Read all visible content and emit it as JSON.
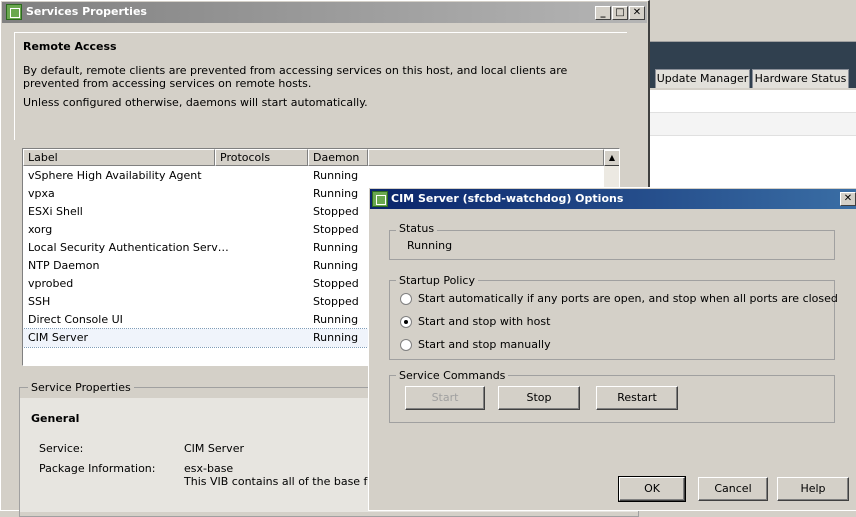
{
  "background_app": {
    "tabs": [
      "Update Manager",
      "Hardware Status"
    ]
  },
  "services_window": {
    "title": "Services Properties",
    "section_heading": "Remote Access",
    "description": "By default, remote clients are prevented from accessing services on this host, and local clients are prevented from accessing services on remote hosts.",
    "daemon_note": "Unless configured otherwise, daemons will start automatically.",
    "columns": [
      "Label",
      "Protocols",
      "Daemon"
    ],
    "rows": [
      {
        "label": "vSphere High Availability Agent",
        "protocols": "",
        "daemon": "Running"
      },
      {
        "label": "vpxa",
        "protocols": "",
        "daemon": "Running"
      },
      {
        "label": "ESXi Shell",
        "protocols": "",
        "daemon": "Stopped"
      },
      {
        "label": "xorg",
        "protocols": "",
        "daemon": "Stopped"
      },
      {
        "label": "Local Security Authentication Serv…",
        "protocols": "",
        "daemon": "Running"
      },
      {
        "label": "NTP Daemon",
        "protocols": "",
        "daemon": "Running"
      },
      {
        "label": "vprobed",
        "protocols": "",
        "daemon": "Stopped"
      },
      {
        "label": "SSH",
        "protocols": "",
        "daemon": "Stopped"
      },
      {
        "label": "Direct Console UI",
        "protocols": "",
        "daemon": "Running"
      },
      {
        "label": "CIM Server",
        "protocols": "",
        "daemon": "Running"
      }
    ],
    "selected_row": "CIM Server",
    "service_properties": {
      "group_label": "Service Properties",
      "general_heading": "General",
      "service_label": "Service:",
      "service_value": "CIM Server",
      "package_label": "Package Information:",
      "package_value": "esx-base",
      "package_desc": "This VIB contains all of the base functio"
    }
  },
  "cim_dialog": {
    "title": "CIM Server (sfcbd-watchdog) Options",
    "status_group": "Status",
    "status_value": "Running",
    "startup_group": "Startup Policy",
    "startup_options": [
      {
        "label": "Start automatically if any ports are open, and stop when all ports are closed",
        "checked": false
      },
      {
        "label": "Start and stop with host",
        "checked": true
      },
      {
        "label": "Start and stop manually",
        "checked": false
      }
    ],
    "commands_group": "Service Commands",
    "start_label": "Start",
    "stop_label": "Stop",
    "restart_label": "Restart",
    "ok_label": "OK",
    "cancel_label": "Cancel",
    "help_label": "Help"
  }
}
